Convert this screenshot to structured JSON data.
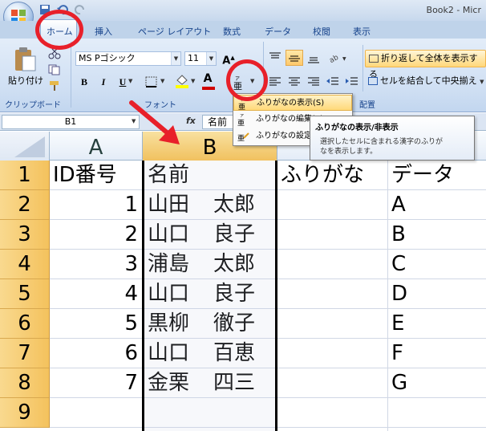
{
  "window": {
    "title": "Book2 - Micr"
  },
  "tabs": [
    "ホーム",
    "挿入",
    "ページ レイアウト",
    "数式",
    "データ",
    "校閲",
    "表示"
  ],
  "clipboard": {
    "paste_label": "貼り付け",
    "group_label": "クリップボード"
  },
  "font": {
    "name": "MS Pゴシック",
    "size": "11",
    "bold": "B",
    "italic": "I",
    "underline": "U",
    "group_label": "フォント",
    "color_bar": "#d00000",
    "fill_bar": "#ffff00"
  },
  "alignment": {
    "wrap_label": "折り返して全体を表示する",
    "merge_label": "セルを結合して中央揃え",
    "group_label": "配置"
  },
  "phonetic_menu": {
    "items": [
      "ふりがなの表示(S)",
      "ふりがなの編集(E)",
      "ふりがなの設定"
    ]
  },
  "tooltip": {
    "title": "ふりがなの表示/非表示",
    "desc_line1": "選択したセルに含まれる漢字のふりが",
    "desc_line2": "なを表示します。"
  },
  "formula_bar": {
    "name_box": "B1",
    "fx": "fx",
    "content": "名前"
  },
  "sheet": {
    "columns": [
      "A",
      "B",
      "",
      ""
    ],
    "rows": [
      "1",
      "2",
      "3",
      "4",
      "5",
      "6",
      "7",
      "8",
      "9"
    ],
    "header_row": [
      "ID番号",
      "名前",
      "ふりがな",
      "データ"
    ],
    "data": [
      {
        "id": "1",
        "name_last": "山田",
        "name_first": "太郎",
        "data": "A"
      },
      {
        "id": "2",
        "name_last": "山口",
        "name_first": "良子",
        "data": "B"
      },
      {
        "id": "3",
        "name_last": "浦島",
        "name_first": "太郎",
        "data": "C"
      },
      {
        "id": "4",
        "name_last": "山口",
        "name_first": "良子",
        "data": "D"
      },
      {
        "id": "5",
        "name_last": "黒柳",
        "name_first": "徹子",
        "data": "E"
      },
      {
        "id": "6",
        "name_last": "山口",
        "name_first": "百恵",
        "data": "F"
      },
      {
        "id": "7",
        "name_last": "金栗",
        "name_first": "四三",
        "data": "G"
      }
    ]
  },
  "colors": {
    "annotation": "#e8202a",
    "selected_header": "#f1c15f"
  }
}
